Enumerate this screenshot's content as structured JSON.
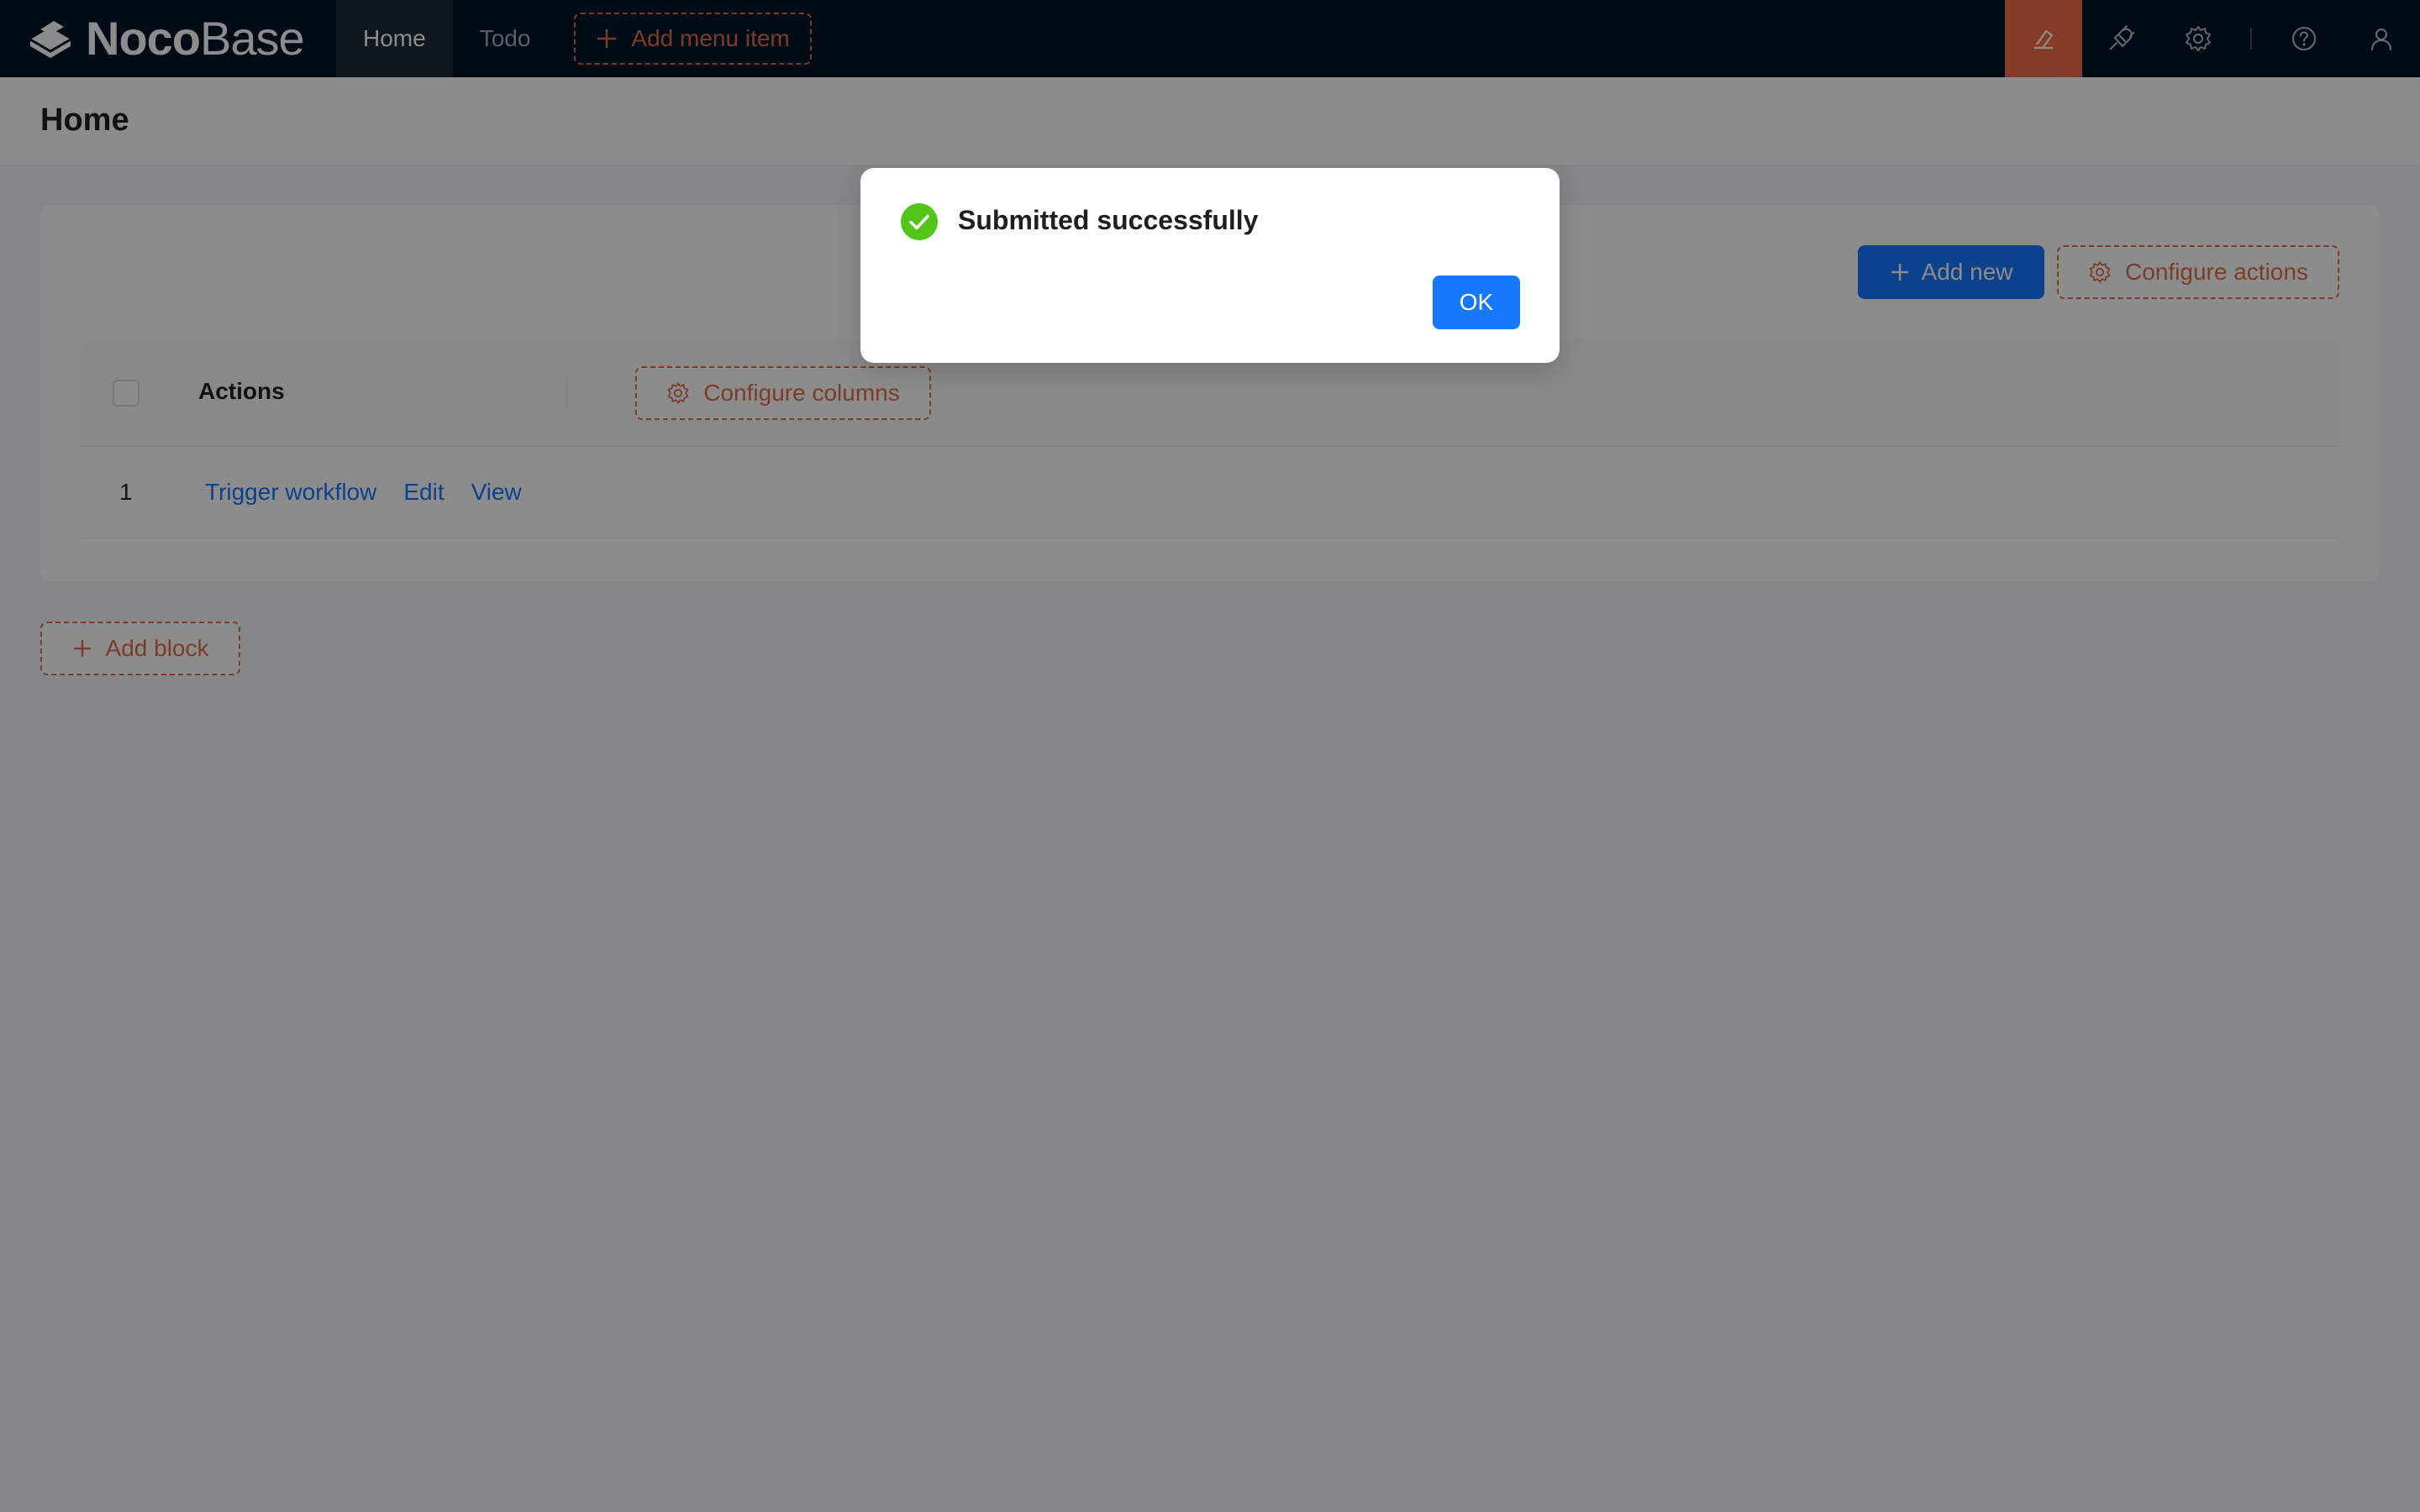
{
  "header": {
    "logo": {
      "bold": "Noco",
      "light": "Base"
    },
    "nav": [
      {
        "label": "Home",
        "active": true
      },
      {
        "label": "Todo",
        "active": false
      }
    ],
    "add_menu_item_label": "Add menu item",
    "icons": [
      "ui-editor-icon",
      "plugin-icon",
      "settings-icon",
      "help-icon",
      "user-icon"
    ],
    "accent_color": "#f26d47"
  },
  "page": {
    "title": "Home"
  },
  "block": {
    "add_new_label": "Add new",
    "configure_actions_label": "Configure actions",
    "table": {
      "header_actions": "Actions",
      "configure_columns_label": "Configure columns",
      "rows": [
        {
          "index": "1",
          "links": [
            "Trigger workflow",
            "Edit",
            "View"
          ]
        }
      ]
    }
  },
  "add_block_label": "Add block",
  "modal": {
    "title": "Submitted successfully",
    "ok_label": "OK",
    "status_color": "#52c41a"
  }
}
